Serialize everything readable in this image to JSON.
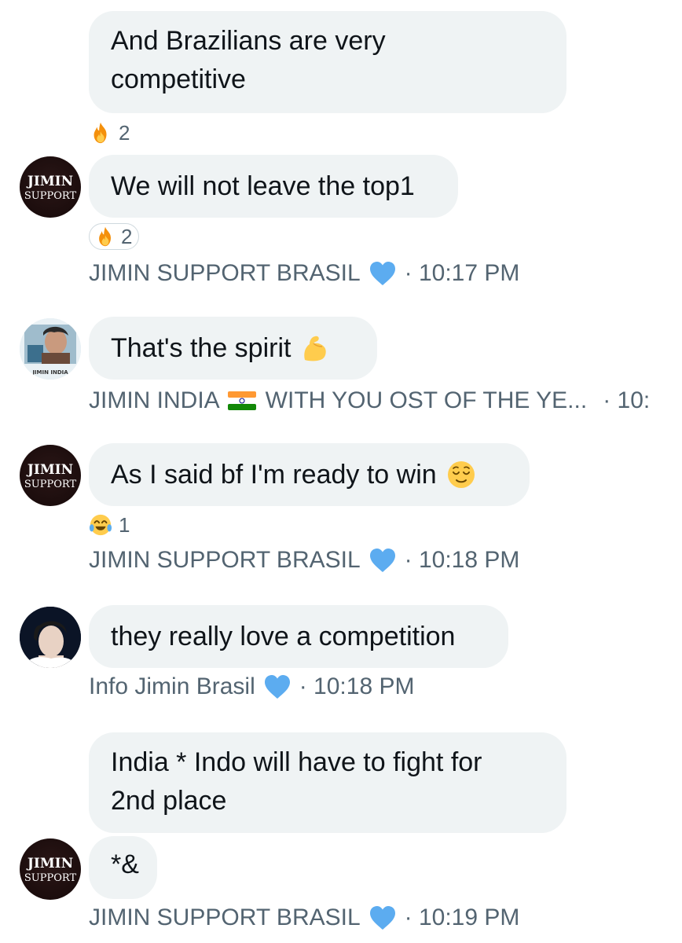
{
  "messages": [
    {
      "text_lines": [
        "And Brazilians are very",
        "competitive"
      ],
      "reaction": {
        "emoji": "fire",
        "count": "2"
      }
    },
    {
      "text": "We will not leave the top1",
      "reaction": {
        "emoji": "fire",
        "count": "2"
      }
    },
    {
      "text": "That's the spirit",
      "emoji": "flexed-biceps"
    },
    {
      "text": "As I said bf I'm ready to win",
      "emoji": "relieved-face",
      "reaction": {
        "emoji": "tears-of-joy",
        "count": "1"
      }
    },
    {
      "text": "they really love a competition"
    },
    {
      "text_lines": [
        "India * Indo will have to fight for",
        "2nd place"
      ]
    },
    {
      "text": "*&"
    }
  ],
  "senders": {
    "jimin_support": {
      "name": "JIMIN SUPPORT BRASIL",
      "avatar_line1": "JIMIN",
      "avatar_line2": "SUPPORT",
      "avatar_prefix": "ı"
    },
    "jimin_india": {
      "name": "JIMIN INDIA",
      "suffix": "WITH YOU OST OF THE YE...",
      "avatar_caption": "JIMIN INDIA",
      "time": "· 10:"
    },
    "info_jimin": {
      "name": "Info Jimin Brasil",
      "time": "· 10:18 PM"
    }
  },
  "timestamps": {
    "t1017": "· 10:17 PM",
    "t1018": "· 10:18 PM",
    "t1019": "· 10:19 PM"
  },
  "colors": {
    "bubble": "#eff3f4",
    "meta_text": "#536471",
    "heart": "#5cacf0"
  }
}
